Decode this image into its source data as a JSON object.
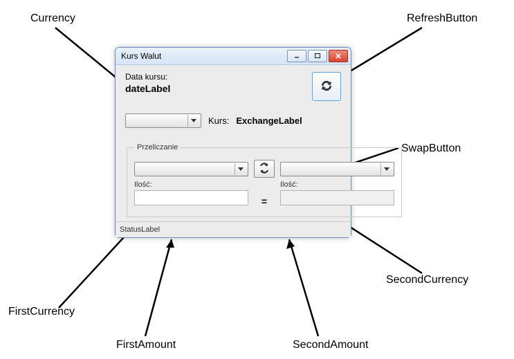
{
  "window": {
    "title": "Kurs Walut",
    "date_title": "Data kursu:",
    "date_value": "dateLabel",
    "rate_label": "Kurs:",
    "rate_value": "ExchangeLabel",
    "currency_selected": "",
    "group_title": "Przeliczanie",
    "amount_label": "Ilość:",
    "first_currency_selected": "",
    "second_currency_selected": "",
    "first_amount": "",
    "second_amount": "",
    "equals": "=",
    "status": "StatusLabel"
  },
  "annotations": {
    "currency": "Currency",
    "refresh": "RefreshButton",
    "swap": "SwapButton",
    "first_currency": "FirstCurrency",
    "second_currency": "SecondCurrency",
    "first_amount": "FirstAmount",
    "second_amount": "SecondAmount"
  }
}
